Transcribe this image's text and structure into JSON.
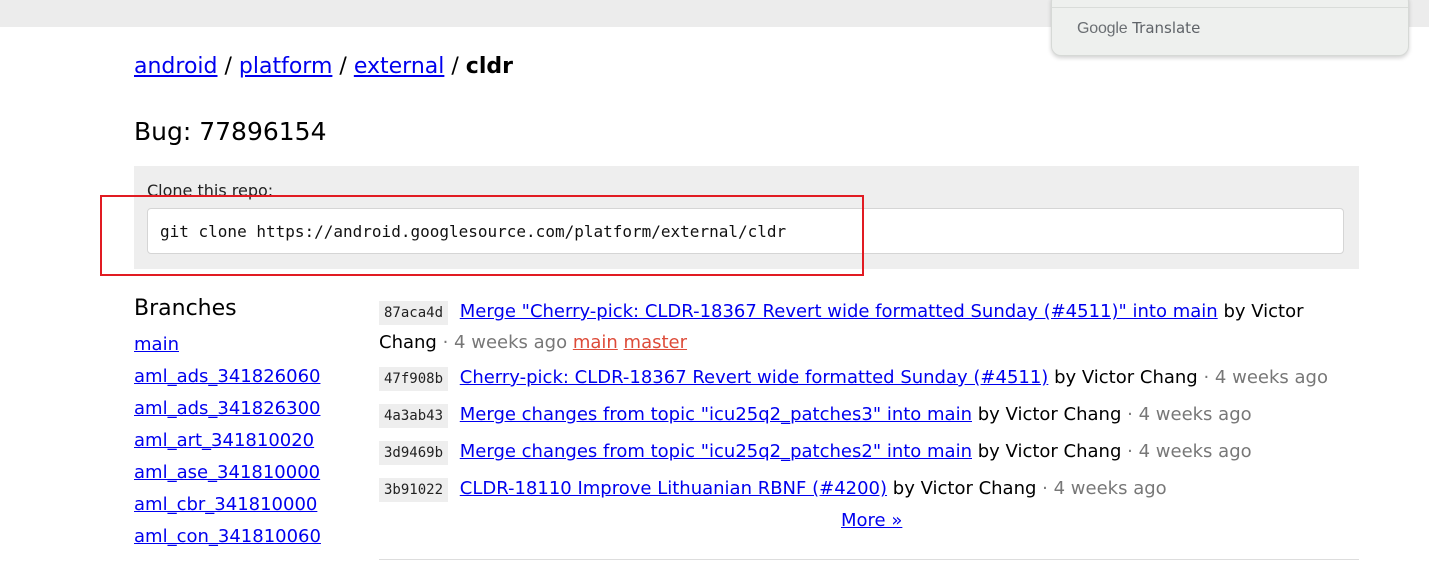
{
  "translate_widget": {
    "brand": "Google",
    "label": "Translate"
  },
  "breadcrumb": {
    "items": [
      "android",
      "platform",
      "external"
    ],
    "current": "cldr",
    "separator": "/"
  },
  "page_title": "Bug: 77896154",
  "clone": {
    "label": "Clone this repo:",
    "command": "git clone https://android.googlesource.com/platform/external/cldr"
  },
  "branches": {
    "title": "Branches",
    "items": [
      "main",
      "aml_ads_341826060",
      "aml_ads_341826300",
      "aml_art_341810020",
      "aml_ase_341810000",
      "aml_cbr_341810000",
      "aml_con_341810060"
    ]
  },
  "commits": [
    {
      "sha": "87aca4d",
      "message": "Merge \"Cherry-pick: CLDR-18367 Revert wide formatted Sunday (#4511)\" into main",
      "author": "by Victor Chang",
      "age": "4 weeks ago",
      "refs": [
        "main",
        "master"
      ]
    },
    {
      "sha": "47f908b",
      "message": "Cherry-pick: CLDR-18367 Revert wide formatted Sunday (#4511)",
      "author": "by Victor Chang",
      "age": "4 weeks ago"
    },
    {
      "sha": "4a3ab43",
      "message": "Merge changes from topic \"icu25q2_patches3\" into main",
      "author": "by Victor Chang",
      "age": "4 weeks ago"
    },
    {
      "sha": "3d9469b",
      "message": "Merge changes from topic \"icu25q2_patches2\" into main",
      "author": "by Victor Chang",
      "age": "4 weeks ago"
    },
    {
      "sha": "3b91022",
      "message": "CLDR-18110 Improve Lithuanian RBNF (#4200)",
      "author": "by Victor Chang",
      "age": "4 weeks ago"
    }
  ],
  "more_link": "More »",
  "colors": {
    "link": "#0000ee",
    "ref": "#dd4b39",
    "highlight": "#e11b22",
    "panel": "#eeeeee"
  }
}
